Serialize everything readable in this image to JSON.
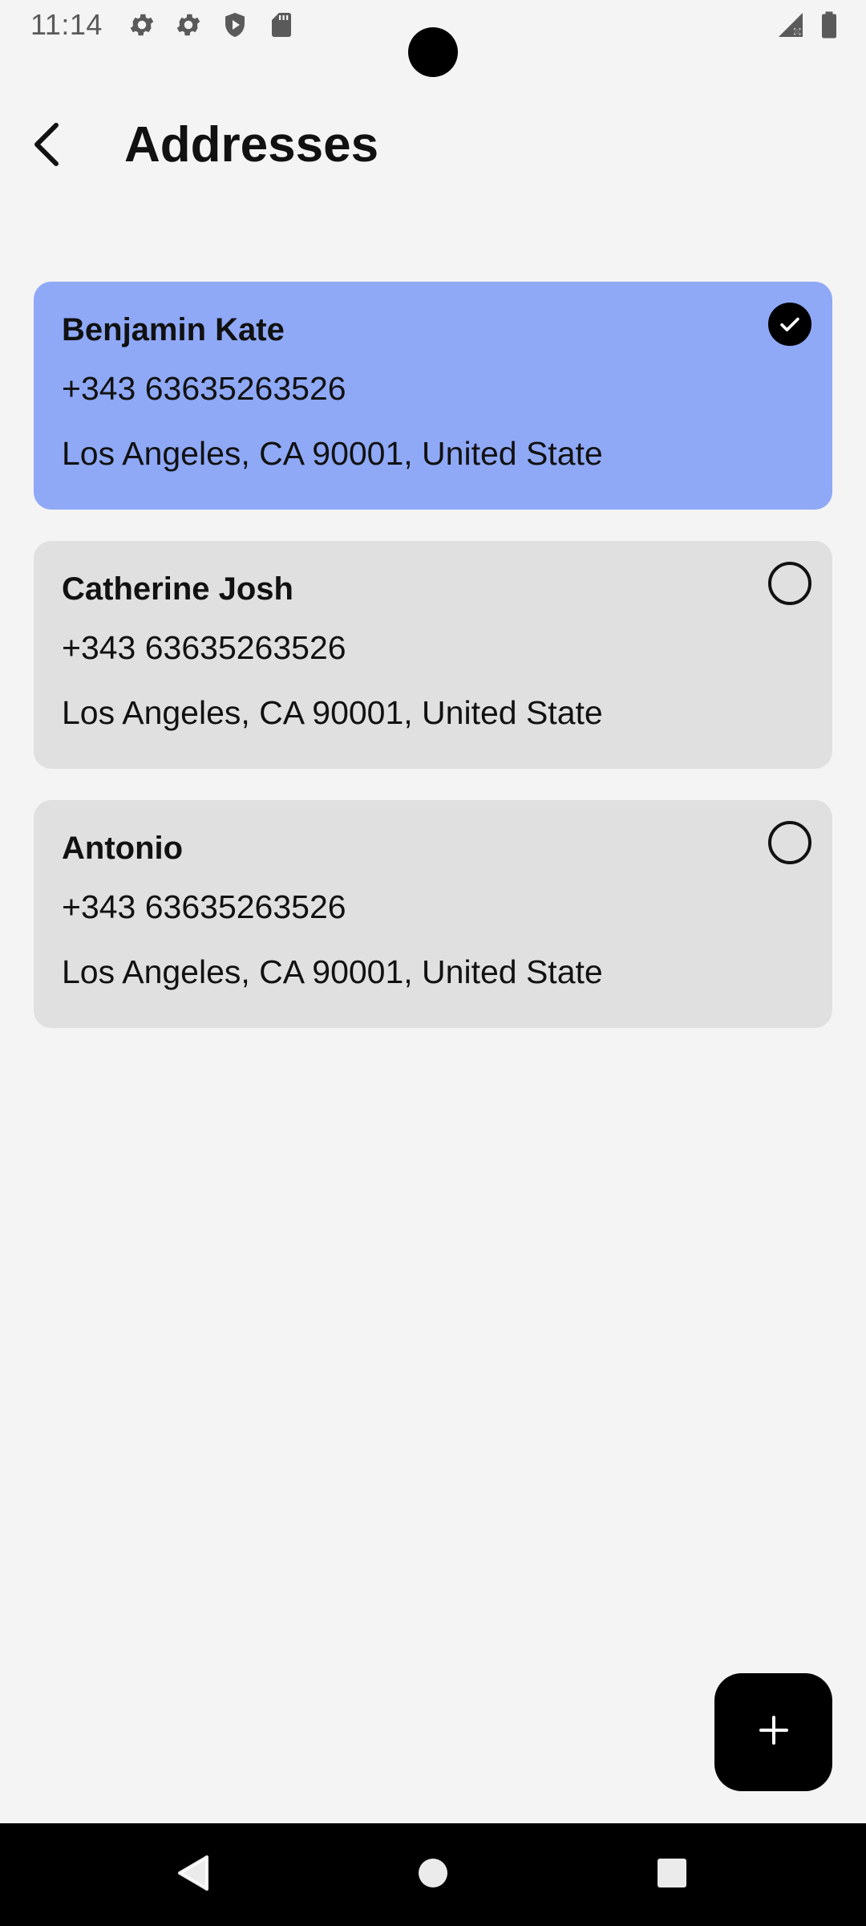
{
  "status_bar": {
    "time": "11:14",
    "icons": [
      "settings-icon",
      "settings-icon",
      "shield-play-icon",
      "sd-card-icon",
      "signal-icon",
      "battery-icon"
    ]
  },
  "header": {
    "back_icon": "back-arrow-icon",
    "title": "Addresses"
  },
  "addresses": [
    {
      "name": "Benjamin Kate",
      "phone": "+343 63635263526",
      "address": "Los Angeles, CA 90001, United State",
      "selected": true
    },
    {
      "name": "Catherine Josh",
      "phone": "+343 63635263526",
      "address": "Los Angeles, CA 90001, United State",
      "selected": false
    },
    {
      "name": "Antonio",
      "phone": "+343 63635263526",
      "address": "Los Angeles, CA 90001, United State",
      "selected": false
    }
  ],
  "fab": {
    "icon": "plus-icon"
  },
  "colors": {
    "background": "#f4f4f4",
    "selected_card": "#8fa9f7",
    "card": "#e0e0e0",
    "fab": "#000000"
  },
  "nav_bar": {
    "icons": [
      "nav-back-icon",
      "nav-home-icon",
      "nav-recents-icon"
    ]
  }
}
